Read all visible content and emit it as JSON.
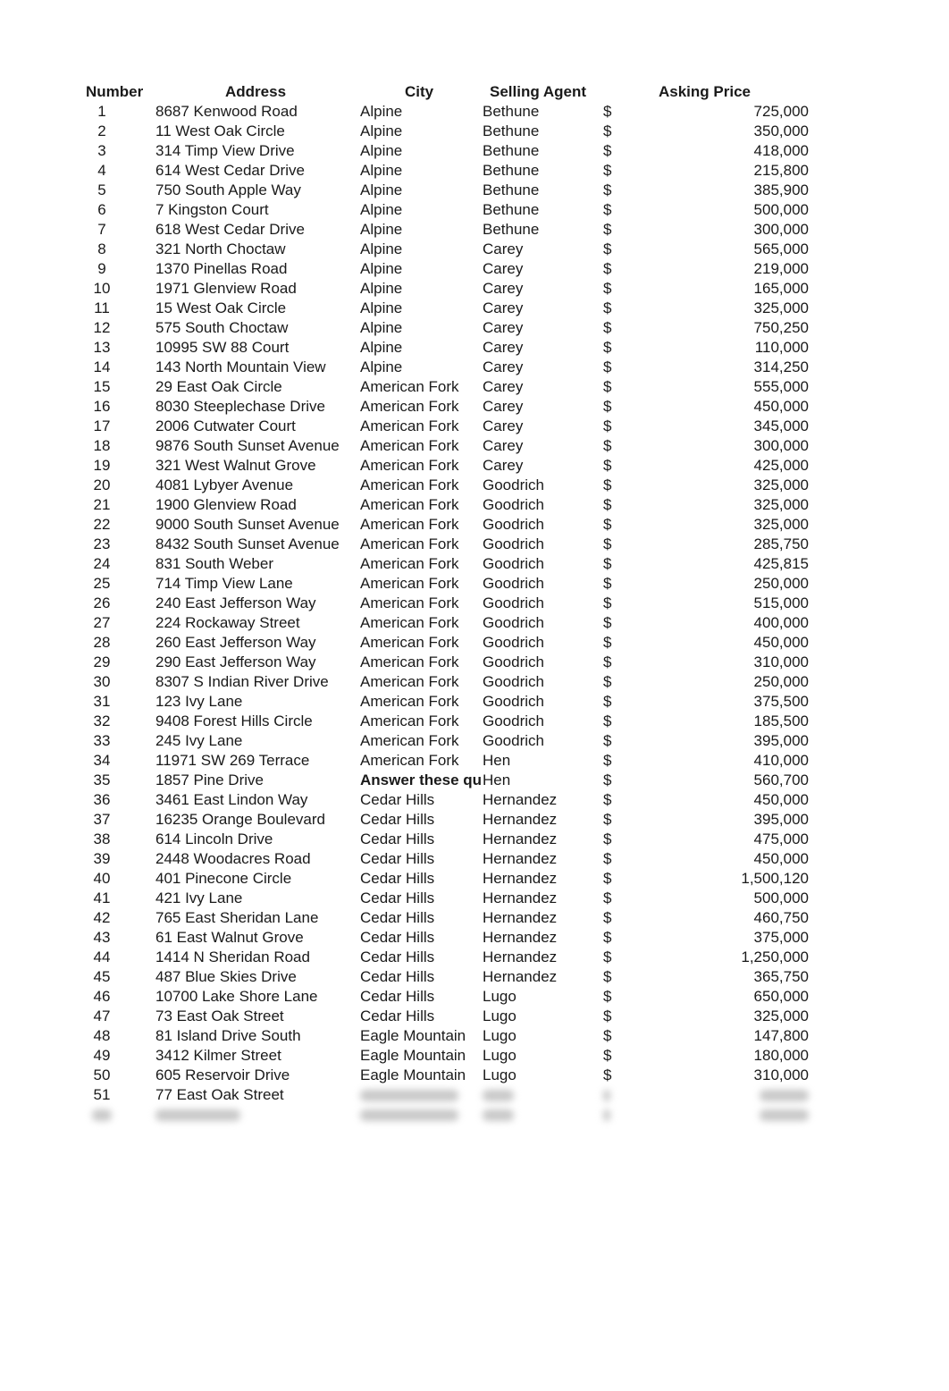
{
  "columns": {
    "number": "Number",
    "address": "Address",
    "city": "City",
    "agent": "Selling Agent",
    "price": "Asking Price"
  },
  "currency_symbol": "$",
  "overlay_note": "Answer these qu",
  "rows": [
    {
      "n": "1",
      "address": "8687 Kenwood Road",
      "city": "Alpine",
      "agent": "Bethune",
      "price": "725,000"
    },
    {
      "n": "2",
      "address": "11 West Oak Circle",
      "city": "Alpine",
      "agent": "Bethune",
      "price": "350,000"
    },
    {
      "n": "3",
      "address": "314 Timp View Drive",
      "city": "Alpine",
      "agent": "Bethune",
      "price": "418,000"
    },
    {
      "n": "4",
      "address": "614 West Cedar Drive",
      "city": "Alpine",
      "agent": "Bethune",
      "price": "215,800"
    },
    {
      "n": "5",
      "address": "750 South Apple Way",
      "city": "Alpine",
      "agent": "Bethune",
      "price": "385,900"
    },
    {
      "n": "6",
      "address": "7 Kingston Court",
      "city": "Alpine",
      "agent": "Bethune",
      "price": "500,000"
    },
    {
      "n": "7",
      "address": "618 West Cedar Drive",
      "city": "Alpine",
      "agent": "Bethune",
      "price": "300,000"
    },
    {
      "n": "8",
      "address": "321 North Choctaw",
      "city": "Alpine",
      "agent": "Carey",
      "price": "565,000"
    },
    {
      "n": "9",
      "address": "1370 Pinellas Road",
      "city": "Alpine",
      "agent": "Carey",
      "price": "219,000"
    },
    {
      "n": "10",
      "address": "1971 Glenview Road",
      "city": "Alpine",
      "agent": "Carey",
      "price": "165,000"
    },
    {
      "n": "11",
      "address": "15 West Oak Circle",
      "city": "Alpine",
      "agent": "Carey",
      "price": "325,000"
    },
    {
      "n": "12",
      "address": "575 South Choctaw",
      "city": "Alpine",
      "agent": "Carey",
      "price": "750,250"
    },
    {
      "n": "13",
      "address": "10995 SW 88 Court",
      "city": "Alpine",
      "agent": "Carey",
      "price": "110,000"
    },
    {
      "n": "14",
      "address": "143 North Mountain View",
      "city": "Alpine",
      "agent": "Carey",
      "price": "314,250"
    },
    {
      "n": "15",
      "address": "29 East Oak Circle",
      "city": "American Fork",
      "agent": "Carey",
      "price": "555,000"
    },
    {
      "n": "16",
      "address": "8030 Steeplechase Drive",
      "city": "American Fork",
      "agent": "Carey",
      "price": "450,000"
    },
    {
      "n": "17",
      "address": "2006 Cutwater Court",
      "city": "American Fork",
      "agent": "Carey",
      "price": "345,000"
    },
    {
      "n": "18",
      "address": "9876 South Sunset Avenue",
      "city": "American Fork",
      "agent": "Carey",
      "price": "300,000"
    },
    {
      "n": "19",
      "address": "321 West Walnut Grove",
      "city": "American Fork",
      "agent": "Carey",
      "price": "425,000"
    },
    {
      "n": "20",
      "address": "4081 Lybyer Avenue",
      "city": "American Fork",
      "agent": "Goodrich",
      "price": "325,000"
    },
    {
      "n": "21",
      "address": "1900 Glenview Road",
      "city": "American Fork",
      "agent": "Goodrich",
      "price": "325,000"
    },
    {
      "n": "22",
      "address": "9000 South Sunset Avenue",
      "city": "American Fork",
      "agent": "Goodrich",
      "price": "325,000"
    },
    {
      "n": "23",
      "address": "8432 South Sunset Avenue",
      "city": "American Fork",
      "agent": "Goodrich",
      "price": "285,750"
    },
    {
      "n": "24",
      "address": "831 South Weber",
      "city": "American Fork",
      "agent": "Goodrich",
      "price": "425,815"
    },
    {
      "n": "25",
      "address": "714 Timp View Lane",
      "city": "American Fork",
      "agent": "Goodrich",
      "price": "250,000"
    },
    {
      "n": "26",
      "address": "240 East Jefferson Way",
      "city": "American Fork",
      "agent": "Goodrich",
      "price": "515,000"
    },
    {
      "n": "27",
      "address": "224 Rockaway Street",
      "city": "American Fork",
      "agent": "Goodrich",
      "price": "400,000"
    },
    {
      "n": "28",
      "address": "260 East Jefferson Way",
      "city": "American Fork",
      "agent": "Goodrich",
      "price": "450,000"
    },
    {
      "n": "29",
      "address": "290 East Jefferson Way",
      "city": "American Fork",
      "agent": "Goodrich",
      "price": "310,000"
    },
    {
      "n": "30",
      "address": "8307 S Indian River Drive",
      "city": "American Fork",
      "agent": "Goodrich",
      "price": "250,000"
    },
    {
      "n": "31",
      "address": "123 Ivy Lane",
      "city": "American Fork",
      "agent": "Goodrich",
      "price": "375,500"
    },
    {
      "n": "32",
      "address": "9408 Forest Hills Circle",
      "city": "American Fork",
      "agent": "Goodrich",
      "price": "185,500"
    },
    {
      "n": "33",
      "address": "245 Ivy Lane",
      "city": "American Fork",
      "agent": "Goodrich",
      "price": "395,000"
    },
    {
      "n": "34",
      "address": "11971 SW 269 Terrace",
      "city": "American Fork",
      "agent": "Hen",
      "price": "410,000"
    },
    {
      "n": "35",
      "address": "1857 Pine Drive",
      "city": "",
      "agent": "Hen",
      "price": "560,700",
      "note": true
    },
    {
      "n": "36",
      "address": "3461 East Lindon Way",
      "city": "Cedar Hills",
      "agent": "Hernandez",
      "price": "450,000"
    },
    {
      "n": "37",
      "address": "16235 Orange Boulevard",
      "city": "Cedar Hills",
      "agent": "Hernandez",
      "price": "395,000"
    },
    {
      "n": "38",
      "address": "614 Lincoln Drive",
      "city": "Cedar Hills",
      "agent": "Hernandez",
      "price": "475,000"
    },
    {
      "n": "39",
      "address": "2448 Woodacres Road",
      "city": "Cedar Hills",
      "agent": "Hernandez",
      "price": "450,000"
    },
    {
      "n": "40",
      "address": "401 Pinecone Circle",
      "city": "Cedar Hills",
      "agent": "Hernandez",
      "price": "1,500,120"
    },
    {
      "n": "41",
      "address": "421 Ivy Lane",
      "city": "Cedar Hills",
      "agent": "Hernandez",
      "price": "500,000"
    },
    {
      "n": "42",
      "address": "765 East Sheridan Lane",
      "city": "Cedar Hills",
      "agent": "Hernandez",
      "price": "460,750"
    },
    {
      "n": "43",
      "address": "61 East Walnut Grove",
      "city": "Cedar Hills",
      "agent": "Hernandez",
      "price": "375,000"
    },
    {
      "n": "44",
      "address": "1414 N Sheridan Road",
      "city": "Cedar Hills",
      "agent": "Hernandez",
      "price": "1,250,000"
    },
    {
      "n": "45",
      "address": "487 Blue Skies Drive",
      "city": "Cedar Hills",
      "agent": "Hernandez",
      "price": "365,750"
    },
    {
      "n": "46",
      "address": "10700 Lake Shore Lane",
      "city": "Cedar Hills",
      "agent": "Lugo",
      "price": "650,000"
    },
    {
      "n": "47",
      "address": "73 East Oak Street",
      "city": "Cedar Hills",
      "agent": "Lugo",
      "price": "325,000"
    },
    {
      "n": "48",
      "address": "81 Island Drive South",
      "city": "Eagle Mountain",
      "agent": "Lugo",
      "price": "147,800"
    },
    {
      "n": "49",
      "address": "3412 Kilmer Street",
      "city": "Eagle Mountain",
      "agent": "Lugo",
      "price": "180,000"
    },
    {
      "n": "50",
      "address": "605 Reservoir Drive",
      "city": "Eagle Mountain",
      "agent": "Lugo",
      "price": "310,000"
    },
    {
      "n": "51",
      "address": "77 East Oak Street",
      "city": "",
      "agent": "",
      "price": "",
      "blurred_tail": true
    },
    {
      "n": "",
      "address": "",
      "city": "",
      "agent": "",
      "price": "",
      "fully_blurred": true
    }
  ]
}
